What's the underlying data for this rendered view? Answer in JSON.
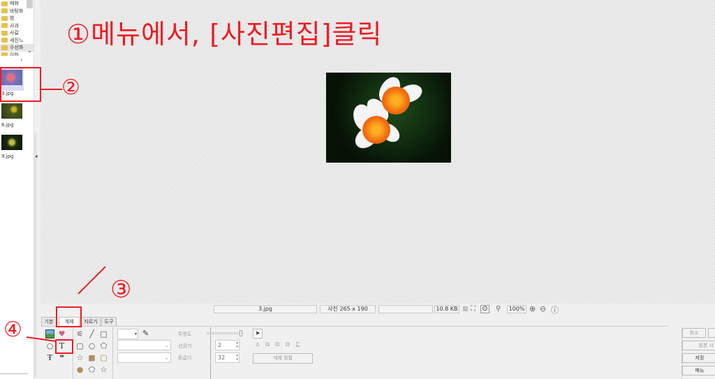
{
  "folders": [
    "매화",
    "바탕화",
    "밤",
    "사과",
    "사갈",
    "세진느",
    "수선화",
    "이하"
  ],
  "thumbnails": [
    {
      "label": "3.jpg"
    },
    {
      "label": "6.jpg"
    },
    {
      "label": "9.jpg"
    }
  ],
  "status": {
    "filename": "3.jpg",
    "dimensions": "사진 265 x 190",
    "empty": "",
    "filesize": "10.8 KB",
    "zoom": "100%"
  },
  "tabs": [
    "기본",
    "개체",
    "자르기",
    "도구"
  ],
  "props": {
    "opacity_label": "투명도",
    "line_width_label": "선굵기",
    "line_width_value": "2",
    "roundness_label": "둥글기",
    "roundness_value": "32",
    "align_button": "개체 정렬"
  },
  "right_buttons": {
    "cancel": "취소",
    "original": "원본 사",
    "save": "저장",
    "menu": "메뉴"
  },
  "annotations": {
    "step1": "①메뉴에서, [사진편집]클릭",
    "step2": "②",
    "step3": "③",
    "step4": "④"
  },
  "colors": {
    "annotation": "#ee1c24"
  }
}
